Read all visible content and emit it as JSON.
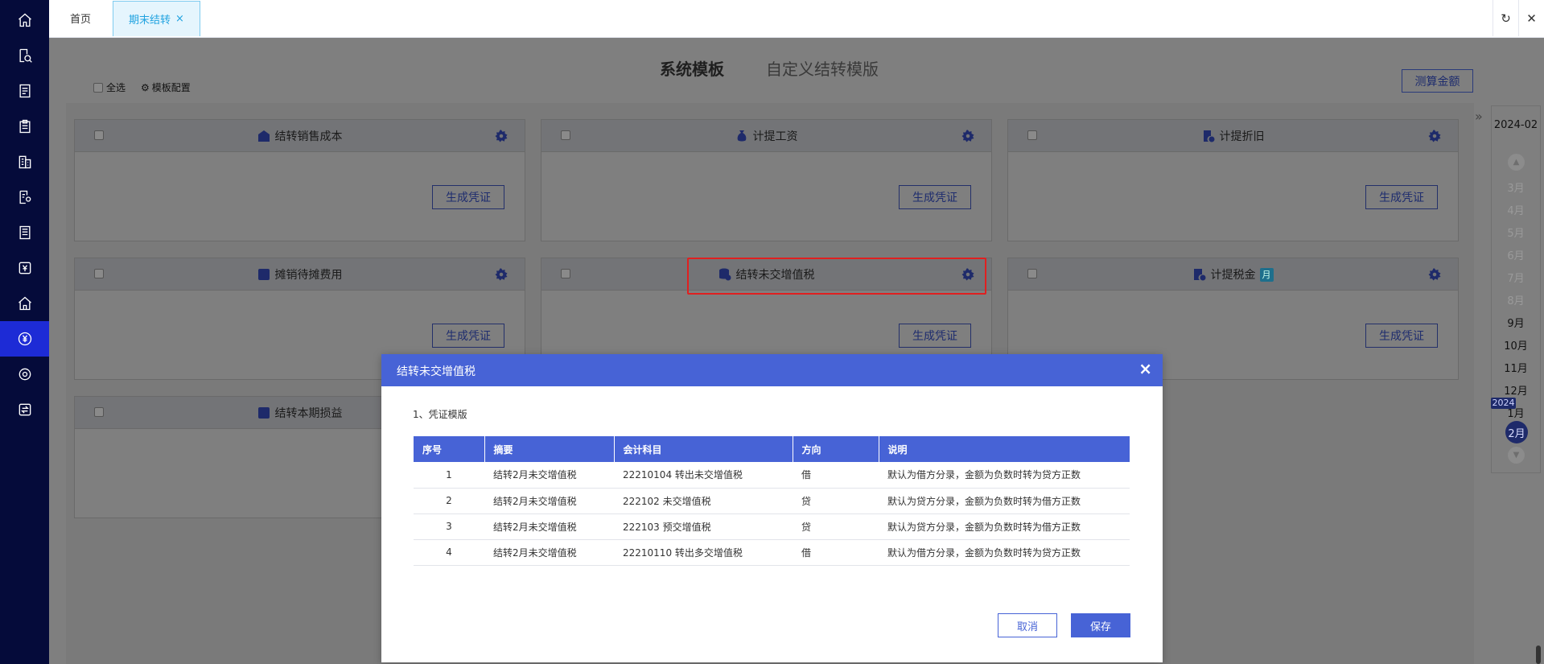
{
  "sidebar": {
    "items": [
      {
        "icon": "home-icon"
      },
      {
        "icon": "search-document-icon"
      },
      {
        "icon": "document-list-icon"
      },
      {
        "icon": "clipboard-icon"
      },
      {
        "icon": "building-icon"
      },
      {
        "icon": "document-settings-icon"
      },
      {
        "icon": "report-icon"
      },
      {
        "icon": "yen-ledger-icon"
      },
      {
        "icon": "house-icon"
      },
      {
        "icon": "yen-circle-icon",
        "active": true
      },
      {
        "icon": "gear-icon"
      },
      {
        "icon": "transfer-icon"
      }
    ]
  },
  "tabs": {
    "home_label": "首页",
    "active_label": "期末结转",
    "close_symbol": "×",
    "refresh_symbol": "↻",
    "close_window_symbol": "✕"
  },
  "main": {
    "template_tabs": {
      "system": "系统模板",
      "custom": "自定义结转模版"
    },
    "select_all": "全选",
    "template_config": "模板配置",
    "calc_button": "测算金额",
    "generate_label": "生成凭证",
    "cards": [
      {
        "title": "结转销售成本",
        "icon": "house-shield-icon"
      },
      {
        "title": "计提工资",
        "icon": "money-bag-icon"
      },
      {
        "title": "计提折旧",
        "icon": "document-clock-icon"
      },
      {
        "title": "摊销待摊费用",
        "icon": "person-coins-icon"
      },
      {
        "title": "结转未交增值税",
        "icon": "database-coin-icon"
      },
      {
        "title": "计提税金",
        "icon": "tax-doc-icon",
        "badge": "月"
      },
      {
        "title": "结转本期损益",
        "icon": "chart-doc-icon"
      }
    ]
  },
  "months": {
    "current": "2024-02",
    "list": [
      "3月",
      "4月",
      "5月",
      "6月",
      "7月",
      "8月",
      "9月",
      "10月",
      "11月",
      "12月",
      "1月"
    ],
    "year_badge": "2024",
    "selected": "2月"
  },
  "modal": {
    "title": "结转未交增值税",
    "close_symbol": "×",
    "section_title": "1、凭证模版",
    "columns": [
      "序号",
      "摘要",
      "会计科目",
      "方向",
      "说明"
    ],
    "rows": [
      {
        "no": "1",
        "summary": "结转2月未交增值税",
        "account": "22210104 转出未交增值税",
        "direction": "借",
        "note": "默认为借方分录，金额为负数时转为贷方正数"
      },
      {
        "no": "2",
        "summary": "结转2月未交增值税",
        "account": "222102 未交增值税",
        "direction": "贷",
        "note": "默认为贷方分录，金额为负数时转为借方正数"
      },
      {
        "no": "3",
        "summary": "结转2月未交增值税",
        "account": "222103 预交增值税",
        "direction": "贷",
        "note": "默认为贷方分录，金额为负数时转为借方正数"
      },
      {
        "no": "4",
        "summary": "结转2月未交增值税",
        "account": "22210110 转出多交增值税",
        "direction": "借",
        "note": "默认为借方分录，金额为负数时转为贷方正数"
      }
    ],
    "cancel_label": "取消",
    "save_label": "保存"
  },
  "colors": {
    "sidebar_bg": "#050b3a",
    "sidebar_active": "#1d2bd6",
    "tab_active": "#21a3e0",
    "modal_accent": "#4763d6",
    "highlight_border": "#e02020"
  }
}
